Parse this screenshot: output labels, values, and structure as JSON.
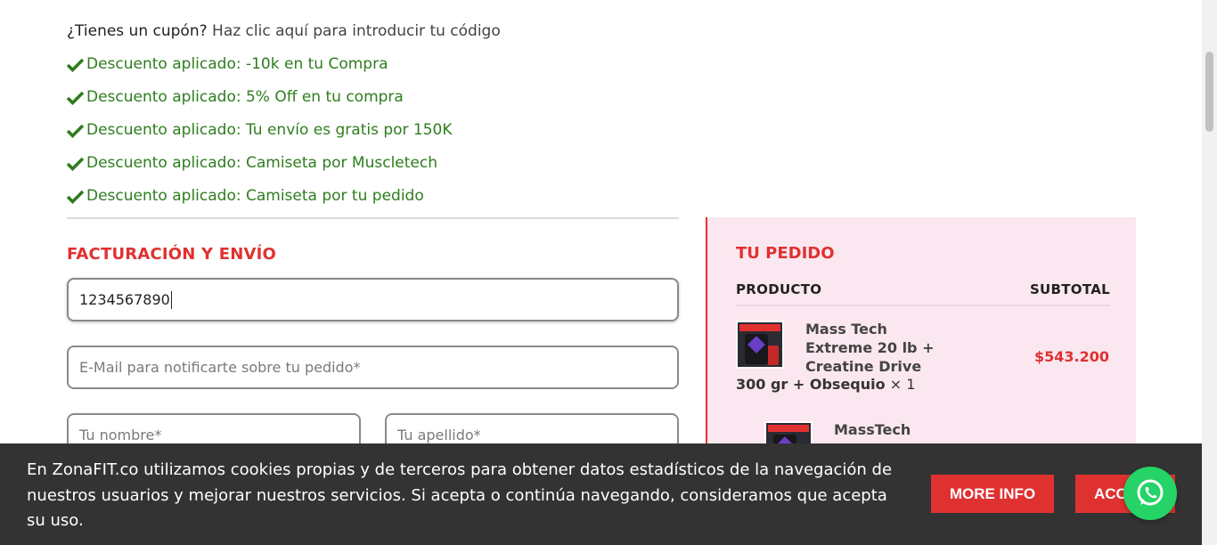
{
  "coupon": {
    "question": "¿Tienes un cupón?",
    "link": "Haz clic aquí para introducir tu código"
  },
  "notices": [
    "Descuento aplicado: -10k en tu Compra",
    "Descuento aplicado: 5% Off en tu compra",
    "Descuento aplicado: Tu envío es gratis por 150K",
    "Descuento aplicado: Camiseta por Muscletech",
    "Descuento aplicado: Camiseta por tu pedido"
  ],
  "billing": {
    "title": "FACTURACIÓN Y ENVÍO",
    "phone_value": "1234567890",
    "email_placeholder": "E-Mail para notificarte sobre tu pedido*",
    "first_name_placeholder": "Tu nombre*",
    "last_name_placeholder": "Tu apellido*"
  },
  "order": {
    "title": "TU PEDIDO",
    "col_product": "PRODUCTO",
    "col_subtotal": "SUBTOTAL",
    "items": [
      {
        "name_lines": "Mass Tech Extreme 20 lb + Creatine Drive",
        "name_tail": "300 gr + Obsequio",
        "qty": "× 1",
        "price": "$543.200"
      },
      {
        "name_lines": "MassTech",
        "name_tail": "",
        "qty": "",
        "price": ""
      }
    ]
  },
  "cookie": {
    "text": "En ZonaFIT.co utilizamos cookies propias y de terceros para obtener datos estadísticos de la navegación de nuestros usuarios y mejorar nuestros servicios. Si acepta o continúa navegando, consideramos que acepta su uso.",
    "more_info": "MORE INFO",
    "accept": "ACCEPT"
  },
  "colors": {
    "accent": "#e03131",
    "success": "#2e7d1e",
    "panel_bg": "#fbe7ef",
    "cookie_bg": "#333333",
    "whatsapp": "#25d366"
  },
  "icons": {
    "notice": "check-icon",
    "chat": "whatsapp-icon"
  }
}
